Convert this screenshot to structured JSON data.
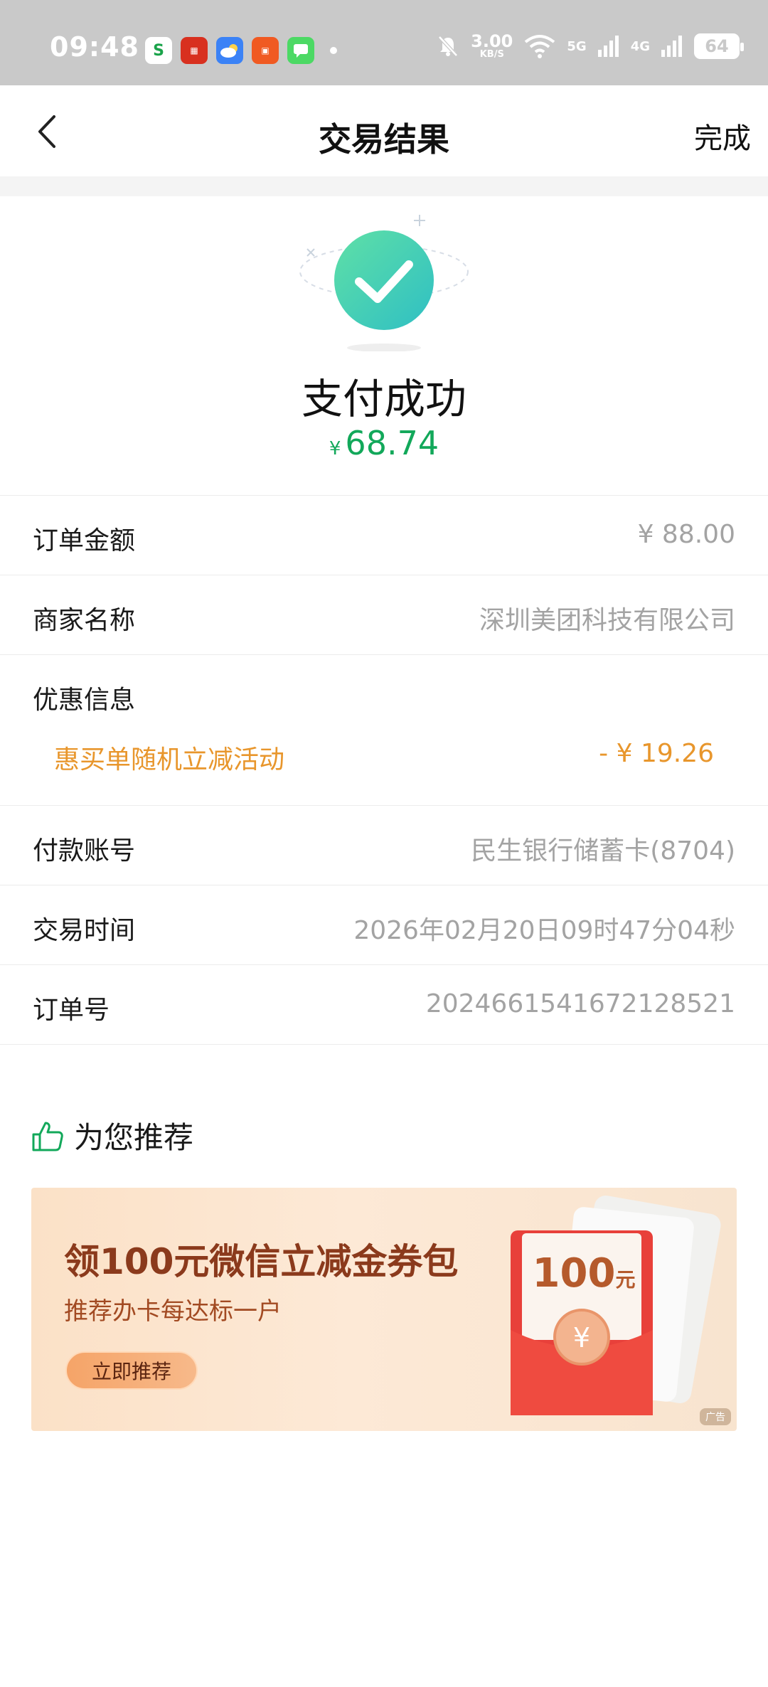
{
  "status_bar": {
    "time": "09:48",
    "speed_value": "3.00",
    "speed_unit": "KB/S",
    "net_5g": "5G",
    "net_4g": "4G",
    "battery": "64"
  },
  "nav": {
    "title": "交易结果",
    "done_label": "完成"
  },
  "result": {
    "status_text": "支付成功",
    "currency_symbol": "¥",
    "amount": "68.74"
  },
  "details": {
    "order_amount_label": "订单金额",
    "order_amount_value": "¥ 88.00",
    "merchant_label": "商家名称",
    "merchant_value": "深圳美团科技有限公司",
    "discount_label": "优惠信息",
    "discount_name": "惠买单随机立减活动",
    "discount_value": "- ¥ 19.26",
    "account_label": "付款账号",
    "account_value": "民生银行储蓄卡(8704)",
    "time_label": "交易时间",
    "time_value": "2026年02月20日09时47分04秒",
    "order_no_label": "订单号",
    "order_no_value": "2024661541672128521"
  },
  "recommend": {
    "title": "为您推荐",
    "banner_title": "领100元微信立减金券包",
    "banner_subtitle": "推荐办卡每达标一户",
    "banner_button": "立即推荐",
    "envelope_amount": "100",
    "envelope_unit": "元",
    "ad_tag": "广告"
  },
  "colors": {
    "success_green": "#12a85a",
    "discount_orange": "#e8962c",
    "muted_gray": "#a3a3a3"
  }
}
